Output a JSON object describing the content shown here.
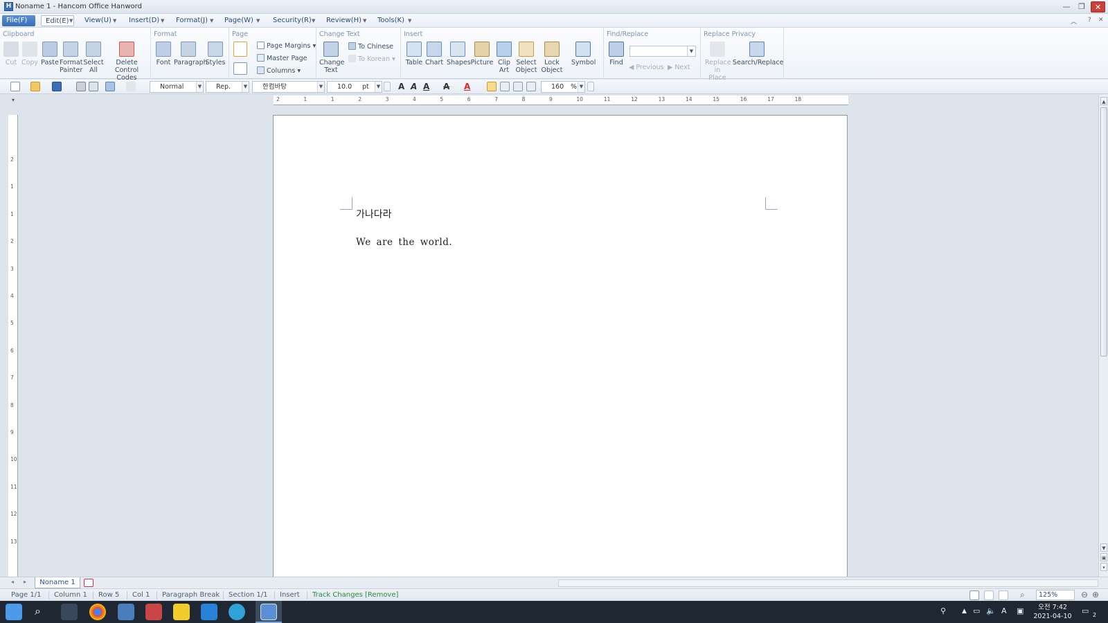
{
  "window": {
    "title": "Noname 1 - Hancom Office Hanword",
    "app_icon": "H",
    "minimize": "—",
    "restore": "❐",
    "close": "✕"
  },
  "menu": {
    "file": "File(F)",
    "items": [
      "Edit(E)",
      "View(U)",
      "Insert(D)",
      "Format(J)",
      "Page(W)",
      "Security(R)",
      "Review(H)",
      "Tools(K)"
    ]
  },
  "ribbon": {
    "clipboard": {
      "title": "Clipboard",
      "cut": "Cut",
      "copy": "Copy",
      "paste": "Paste",
      "format_painter_1": "Format",
      "format_painter_2": "Painter",
      "select_all_1": "Select",
      "select_all_2": "All",
      "delete_codes_1": "Delete Control",
      "delete_codes_2": "Codes"
    },
    "format": {
      "title": "Format",
      "font": "Font",
      "paragraph": "Paragraph",
      "styles": "Styles"
    },
    "page": {
      "title": "Page",
      "page_margins": "Page Margins",
      "master_page": "Master Page",
      "columns": "Columns"
    },
    "change_text": {
      "title": "Change Text",
      "change_text_1": "Change",
      "change_text_2": "Text",
      "to_chinese": "To Chinese",
      "to_korean": "To Korean"
    },
    "insert": {
      "title": "Insert",
      "table": "Table",
      "chart": "Chart",
      "shapes": "Shapes",
      "picture": "Picture",
      "clip_art_1": "Clip",
      "clip_art_2": "Art",
      "select_object_1": "Select",
      "select_object_2": "Object",
      "lock_object_1": "Lock",
      "lock_object_2": "Object",
      "symbol": "Symbol"
    },
    "find_replace": {
      "title": "Find/Replace",
      "find": "Find",
      "find_value": "",
      "previous": "Previous",
      "next": "Next"
    },
    "replace_privacy": {
      "title": "Replace Privacy",
      "replace_in_place_1": "Replace",
      "replace_in_place_2": "in Place",
      "search_replace": "Search/Replace"
    }
  },
  "toolbar": {
    "style": "Normal",
    "rep": "Rep.",
    "font": "한컴바탕",
    "size": "10.0",
    "size_unit": "pt",
    "line_spacing": "160",
    "line_spacing_unit": "%"
  },
  "ruler": {
    "h_labels": [
      "2",
      "1",
      "1",
      "2",
      "3",
      "4",
      "5",
      "6",
      "7",
      "8",
      "9",
      "10",
      "11",
      "12",
      "13",
      "14",
      "15",
      "16",
      "17",
      "18"
    ],
    "v_labels": [
      "2",
      "1",
      "1",
      "2",
      "3",
      "4",
      "5",
      "6",
      "7",
      "8",
      "9",
      "10",
      "11",
      "12",
      "13"
    ]
  },
  "document": {
    "line1": "가나다라",
    "line2": "We are the world."
  },
  "tabs": {
    "doc_tab": "Noname 1"
  },
  "status": {
    "page": "Page 1/1",
    "column": "Column 1",
    "row": "Row 5",
    "col": "Col 1",
    "paragraph": "Paragraph Break",
    "section": "Section 1/1",
    "mode": "Insert",
    "track": "Track Changes [Remove]",
    "zoom": "125%"
  },
  "taskbar": {
    "clock_time": "오전 7:42",
    "clock_date": "2021-04-10",
    "ime": "A",
    "notif_count": "2"
  },
  "colors": {
    "accent": "#3a6fb5",
    "status_green": "#2f8a3a",
    "taskbar_bg": "#1f2733"
  }
}
